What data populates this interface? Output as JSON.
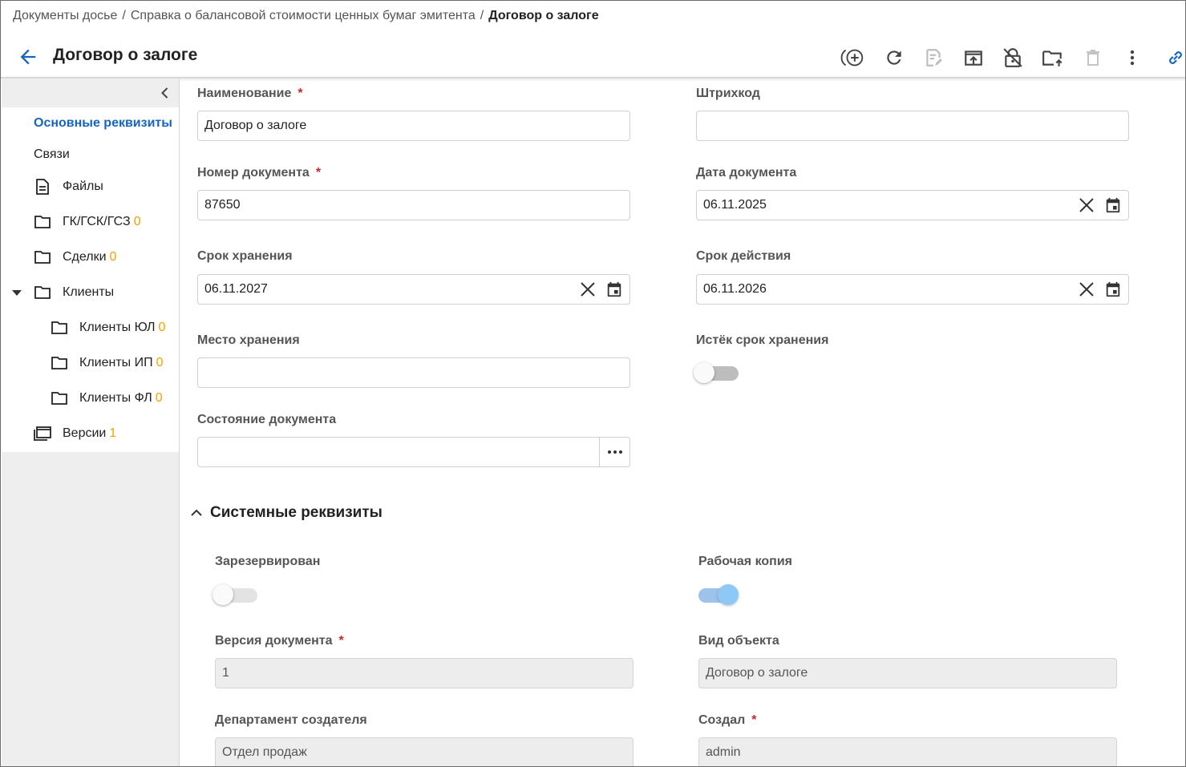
{
  "breadcrumb": {
    "items": [
      "Документы досье",
      "Справка о балансовой стоимости ценных бумаг эмитента"
    ],
    "separator": "/",
    "current": "Договор о залоге"
  },
  "header": {
    "title": "Договор о залоге",
    "toolbar": [
      "add-circle-icon",
      "refresh-icon",
      "edit-document-icon",
      "upload-box-icon",
      "unlock-document-icon",
      "folder-move-icon",
      "delete-icon",
      "more-vertical-icon",
      "link-icon"
    ]
  },
  "sidebar": {
    "items": [
      {
        "label": "Основные реквизиты",
        "active": true
      },
      {
        "label": "Связи"
      },
      {
        "label": "Файлы",
        "icon": "file-icon"
      },
      {
        "label": "ГК/ГСК/ГСЗ",
        "count": "0",
        "icon": "folder-icon"
      },
      {
        "label": "Сделки",
        "count": "0",
        "icon": "folder-icon"
      },
      {
        "label": "Клиенты",
        "icon": "folder-icon",
        "expanded": true
      },
      {
        "label": "Клиенты ЮЛ",
        "count": "0",
        "icon": "folder-icon"
      },
      {
        "label": "Клиенты ИП",
        "count": "0",
        "icon": "folder-icon"
      },
      {
        "label": "Клиенты ФЛ",
        "count": "0",
        "icon": "folder-icon"
      },
      {
        "label": "Версии",
        "count": "1",
        "icon": "versions-icon"
      }
    ]
  },
  "form": {
    "name": {
      "label": "Наименование",
      "required": "*",
      "value": "Договор о залоге"
    },
    "barcode": {
      "label": "Штрихкод",
      "value": ""
    },
    "doc_number": {
      "label": "Номер документа",
      "required": "*",
      "value": "87650"
    },
    "doc_date": {
      "label": "Дата документа",
      "value": "06.11.2025"
    },
    "storage_term": {
      "label": "Срок хранения",
      "value": "06.11.2027"
    },
    "validity_term": {
      "label": "Срок действия",
      "value": "06.11.2026"
    },
    "storage_place": {
      "label": "Место хранения",
      "value": ""
    },
    "storage_expired": {
      "label": "Истёк срок хранения",
      "checked": false
    },
    "doc_state": {
      "label": "Состояние документа",
      "value": ""
    }
  },
  "system_section": {
    "title": "Системные реквизиты",
    "reserved": {
      "label": "Зарезервирован",
      "checked": false
    },
    "working_copy": {
      "label": "Рабочая копия",
      "checked": true
    },
    "doc_version": {
      "label": "Версия документа",
      "required": "*",
      "value": "1"
    },
    "object_type": {
      "label": "Вид объекта",
      "value": "Договор о залоге"
    },
    "creator_department": {
      "label": "Департамент создателя",
      "value": "Отдел продаж"
    },
    "created_by": {
      "label": "Создал",
      "required": "*",
      "value": "admin"
    }
  },
  "colors": {
    "accent": "#1565c0",
    "required": "#c62828",
    "count": "#f5a100",
    "toggle_on": "#8ec8f6"
  }
}
